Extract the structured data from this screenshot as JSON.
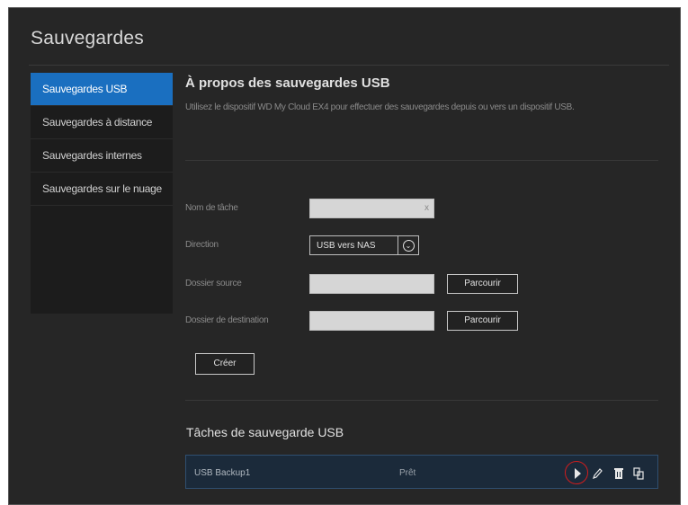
{
  "page": {
    "title": "Sauvegardes"
  },
  "sidebar": {
    "items": [
      {
        "label": "Sauvegardes USB"
      },
      {
        "label": "Sauvegardes à distance"
      },
      {
        "label": "Sauvegardes internes"
      },
      {
        "label": "Sauvegardes sur le nuage"
      }
    ]
  },
  "about": {
    "title": "À propos des sauvegardes USB",
    "description": "Utilisez le dispositif WD My Cloud EX4 pour effectuer des sauvegardes depuis ou vers un dispositif USB."
  },
  "form": {
    "task_name_label": "Nom de tâche",
    "task_name_value": "",
    "clear_icon": "x",
    "direction_label": "Direction",
    "direction_value": "USB vers NAS",
    "source_label": "Dossier source",
    "source_value": "",
    "destination_label": "Dossier de destination",
    "destination_value": "",
    "browse_label": "Parcourir",
    "create_label": "Créer"
  },
  "tasks": {
    "title": "Tâches de sauvegarde USB",
    "rows": [
      {
        "name": "USB Backup1",
        "status": "Prêt"
      }
    ],
    "actions": [
      "play-icon",
      "edit-icon",
      "delete-icon",
      "details-icon"
    ]
  },
  "colors": {
    "background": "#262626",
    "accent": "#1a6fc0",
    "highlight": "#d11d1d"
  }
}
